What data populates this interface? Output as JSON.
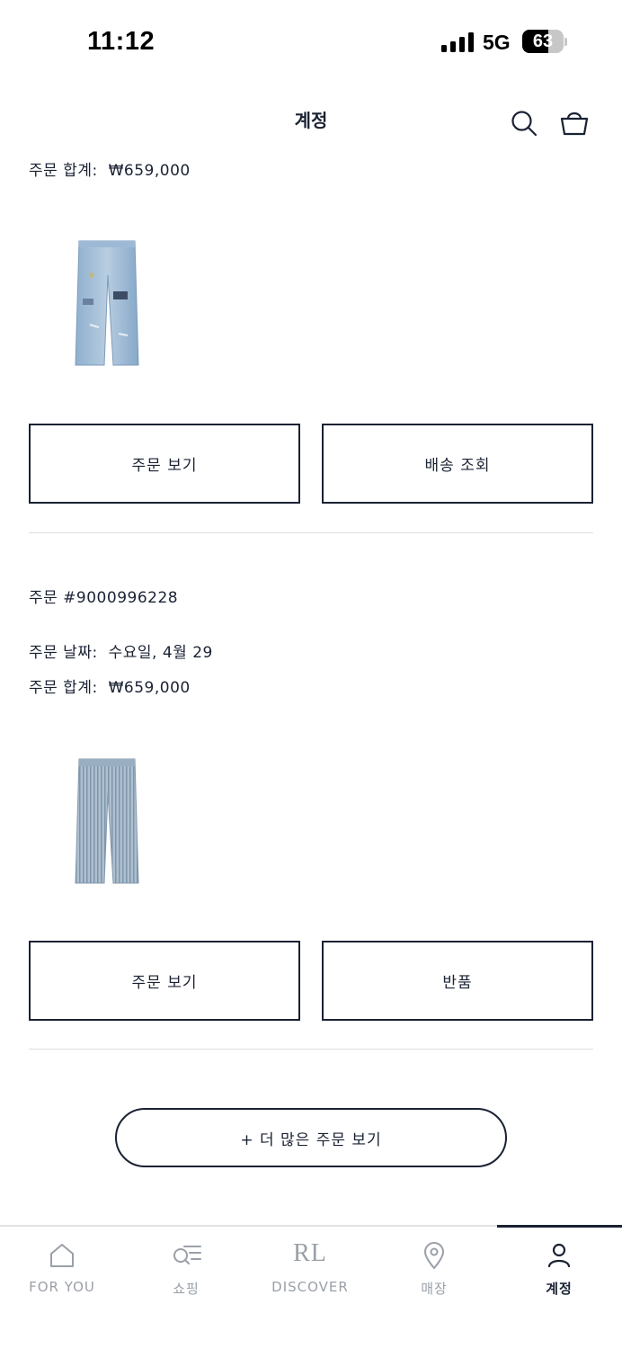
{
  "status_bar": {
    "time": "11:12",
    "network": "5G",
    "battery": "63",
    "battery_level": 0.63
  },
  "header": {
    "title": "계정",
    "search_icon": "search-icon",
    "cart_icon": "shopping-bag-icon"
  },
  "orders": [
    {
      "total_label": "주문 합계:",
      "total_value": "₩659,000",
      "product_image": "light-wash-distressed-jeans",
      "buttons": {
        "view": "주문 보기",
        "secondary": "배송 조회"
      }
    },
    {
      "number": "주문 #9000996228",
      "date_label": "주문 날짜:",
      "date_value": "수요일, 4월 29",
      "total_label": "주문 합계:",
      "total_value": "₩659,000",
      "product_image": "striped-denim-trousers",
      "buttons": {
        "view": "주문 보기",
        "secondary": "반품"
      }
    }
  ],
  "more_orders": "+ 더 많은 주문 보기",
  "tab_bar": {
    "items": [
      {
        "label": "FOR YOU",
        "icon": "home-icon"
      },
      {
        "label": "쇼핑",
        "icon": "shop-search-icon"
      },
      {
        "label": "DISCOVER",
        "logo": "RL"
      },
      {
        "label": "매장",
        "icon": "location-pin-icon"
      },
      {
        "label": "계정",
        "icon": "person-icon",
        "active": true
      }
    ]
  },
  "colors": {
    "ink": "#1a2233",
    "divider": "#dedede",
    "inactive": "#9aa0a8"
  }
}
